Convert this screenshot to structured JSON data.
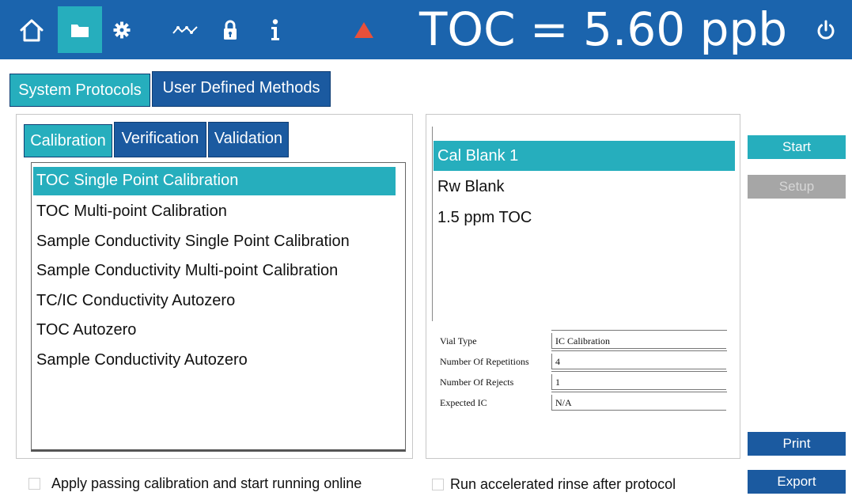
{
  "header": {
    "nav_icons": [
      "home-icon",
      "folder-icon",
      "gear-icon",
      "trend-icon",
      "lock-icon",
      "info-icon",
      "alarm-triangle-icon"
    ],
    "readout": "TOC = 5.60 ppb",
    "power_icon": "power-icon",
    "colors": {
      "bar": "#1b64ad",
      "active": "#26aebd",
      "alarm": "#e8503a"
    }
  },
  "main_tabs": {
    "system_protocols": "System Protocols",
    "user_defined_methods": "User Defined Methods",
    "selected": "System Protocols"
  },
  "sub_tabs": {
    "calibration": "Calibration",
    "verification": "Verification",
    "validation": "Validation",
    "selected": "Calibration"
  },
  "protocols": [
    "TOC Single Point Calibration",
    "TOC Multi-point Calibration",
    "Sample Conductivity Single Point Calibration",
    "Sample Conductivity Multi-point Calibration",
    "TC/IC Conductivity Autozero",
    "TOC Autozero",
    "Sample Conductivity Autozero"
  ],
  "selected_protocol": "TOC Single Point Calibration",
  "steps": [
    "Cal Blank 1",
    "Rw Blank",
    "1.5 ppm TOC"
  ],
  "selected_step": "Cal Blank 1",
  "properties": [
    {
      "label": "Vial Type",
      "value": "IC Calibration"
    },
    {
      "label": "Number Of Repetitions",
      "value": "4"
    },
    {
      "label": "Number Of Rejects",
      "value": "1"
    },
    {
      "label": "Expected IC",
      "value": "N/A"
    }
  ],
  "actions": {
    "start": "Start",
    "setup": "Setup",
    "print": "Print",
    "export": "Export"
  },
  "options": {
    "apply_passing": {
      "label": "Apply passing calibration and start running online",
      "checked": false
    },
    "accelerated_rinse": {
      "label": "Run accelerated rinse after protocol",
      "checked": false
    }
  }
}
